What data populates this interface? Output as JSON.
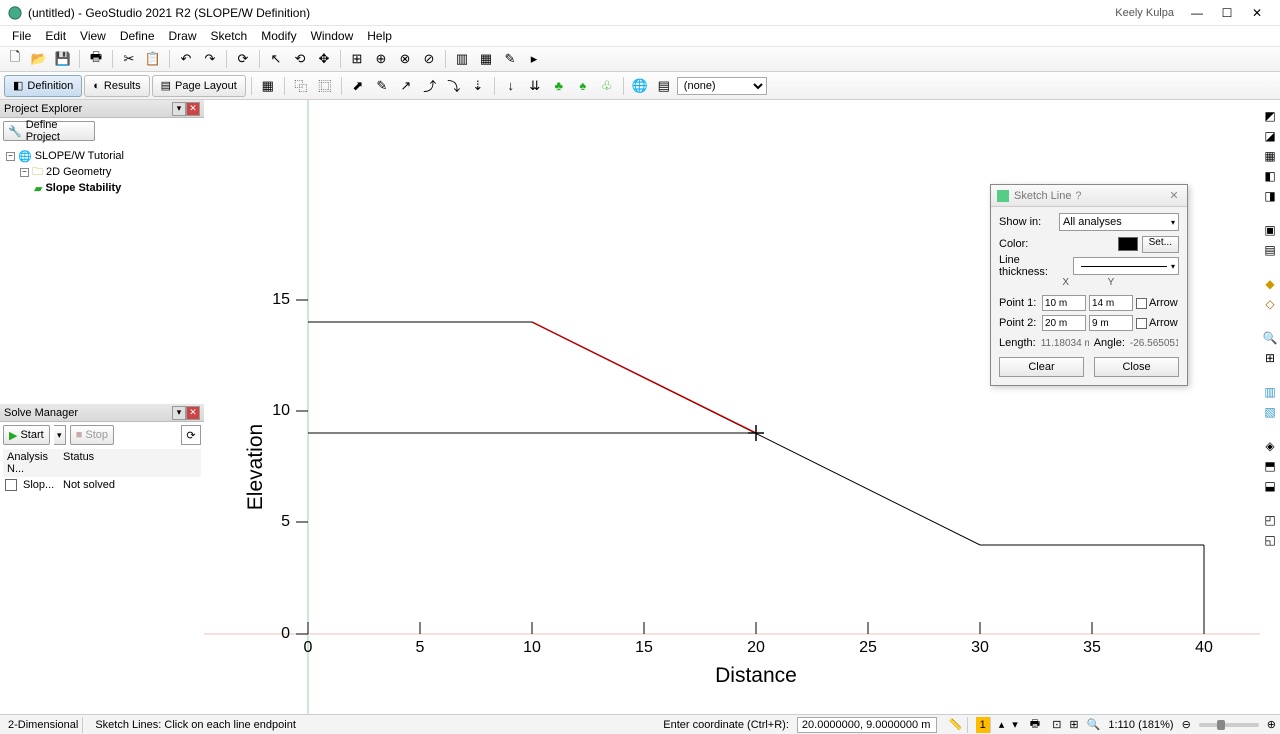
{
  "window": {
    "title": "(untitled) - GeoStudio 2021 R2 (SLOPE/W Definition)",
    "user": "Keely Kulpa"
  },
  "menu": [
    "File",
    "Edit",
    "View",
    "Define",
    "Draw",
    "Sketch",
    "Modify",
    "Window",
    "Help"
  ],
  "tabs": {
    "definition": "Definition",
    "results": "Results",
    "pagelayout": "Page Layout"
  },
  "layer_select": "(none)",
  "project_explorer": {
    "title": "Project Explorer",
    "define_btn": "Define Project",
    "root": "SLOPE/W Tutorial",
    "geom": "2D Geometry",
    "analysis": "Slope Stability"
  },
  "solve_manager": {
    "title": "Solve Manager",
    "start": "Start",
    "stop": "Stop",
    "col1": "Analysis N...",
    "col2": "Status",
    "row_name": "Slop...",
    "row_status": "Not solved"
  },
  "dialog": {
    "title": "Sketch Line",
    "show_in_lbl": "Show in:",
    "show_in_val": "All analyses",
    "color_lbl": "Color:",
    "set_btn": "Set...",
    "thick_lbl": "Line thickness:",
    "xh": "X",
    "yh": "Y",
    "p1_lbl": "Point 1:",
    "p1_x": "10 m",
    "p1_y": "14 m",
    "p2_lbl": "Point 2:",
    "p2_x": "20 m",
    "p2_y": "9 m",
    "arrow": "Arrow",
    "len_lbl": "Length:",
    "len_val": "11.18034 m",
    "ang_lbl": "Angle:",
    "ang_val": "-26.565051 °",
    "clear": "Clear",
    "close": "Close"
  },
  "chart_data": {
    "type": "line",
    "xlabel": "Distance",
    "ylabel": "Elevation",
    "xlim": [
      0,
      40
    ],
    "ylim": [
      0,
      15
    ],
    "x_ticks": [
      0,
      5,
      10,
      15,
      20,
      25,
      30,
      35,
      40
    ],
    "y_ticks": [
      0,
      5,
      10,
      15
    ],
    "series": [
      {
        "name": "geometry_top",
        "color": "#000",
        "points": [
          [
            0,
            14
          ],
          [
            10,
            14
          ],
          [
            30,
            4
          ],
          [
            40,
            4
          ]
        ]
      },
      {
        "name": "geometry_mid",
        "color": "#000",
        "points": [
          [
            0,
            10
          ],
          [
            20,
            10
          ]
        ]
      },
      {
        "name": "sketch_line",
        "color": "#c00",
        "points": [
          [
            10,
            14
          ],
          [
            20,
            9
          ]
        ]
      }
    ],
    "cursor": [
      20,
      10
    ]
  },
  "status": {
    "mode": "2-Dimensional",
    "hint": "Sketch Lines: Click on each line endpoint",
    "coord_lbl": "Enter coordinate (Ctrl+R):",
    "coord_val": "20.0000000, 9.0000000 m",
    "page": "1",
    "zoom": "1:110 (181%)"
  }
}
